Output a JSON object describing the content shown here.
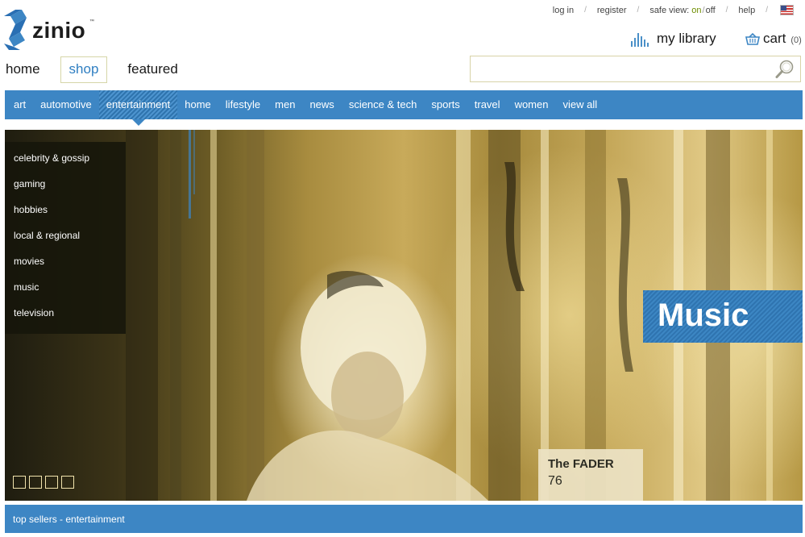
{
  "brand": {
    "name": "zinio",
    "trademark": "™"
  },
  "utility": {
    "login": "log in",
    "register": "register",
    "safe_view_label": "safe view:",
    "safe_view_on": "on",
    "safe_view_slash": "/",
    "safe_view_off": "off",
    "help": "help",
    "separator": "/",
    "flag_icon": "us-flag-icon"
  },
  "account": {
    "library_label": "my library",
    "library_icon": "bar-chart-icon",
    "cart_label": "cart",
    "cart_count": "(0)",
    "cart_icon": "basket-icon"
  },
  "primary_nav": {
    "tabs": [
      {
        "label": "home",
        "active": false
      },
      {
        "label": "shop",
        "active": true
      },
      {
        "label": "featured",
        "active": false
      }
    ]
  },
  "search": {
    "value": "",
    "placeholder": "",
    "icon": "magnifier-icon"
  },
  "categories": [
    {
      "label": "art",
      "active": false
    },
    {
      "label": "automotive",
      "active": false
    },
    {
      "label": "entertainment",
      "active": true
    },
    {
      "label": "home",
      "active": false
    },
    {
      "label": "lifestyle",
      "active": false
    },
    {
      "label": "men",
      "active": false
    },
    {
      "label": "news",
      "active": false
    },
    {
      "label": "science & tech",
      "active": false
    },
    {
      "label": "sports",
      "active": false
    },
    {
      "label": "travel",
      "active": false
    },
    {
      "label": "women",
      "active": false
    },
    {
      "label": "view all",
      "active": false
    }
  ],
  "subcategories": [
    "celebrity & gossip",
    "gaming",
    "hobbies",
    "local & regional",
    "movies",
    "music",
    "television"
  ],
  "hero": {
    "badge": "Music",
    "magazine_title": "The FADER",
    "magazine_issue": "76",
    "slide_count": 4
  },
  "top_sellers": {
    "label": "top sellers - entertainment"
  },
  "colors": {
    "accent_blue": "#3d86c4",
    "safe_view_on": "#6f8e00"
  }
}
